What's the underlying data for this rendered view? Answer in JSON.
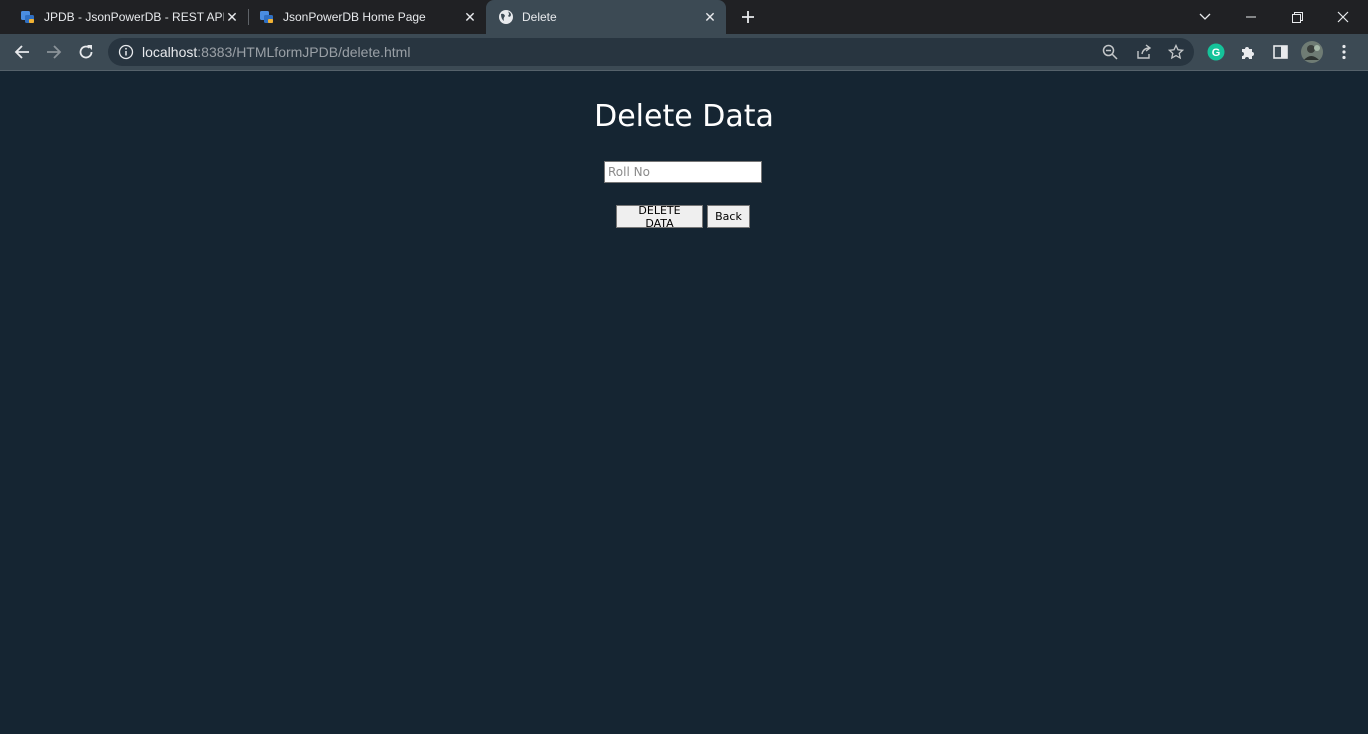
{
  "browser": {
    "tabs": [
      {
        "title": "JPDB - JsonPowerDB - REST API J",
        "active": false,
        "favicon": "jpdb-logo-icon"
      },
      {
        "title": "JsonPowerDB Home Page",
        "active": false,
        "favicon": "jpdb-logo-icon"
      },
      {
        "title": "Delete",
        "active": true,
        "favicon": "globe-icon"
      }
    ],
    "address": {
      "host": "localhost",
      "rest": ":8383/HTMLformJPDB/delete.html"
    },
    "profile_initial": "G"
  },
  "page": {
    "heading": "Delete Data",
    "rollno_placeholder": "Roll No",
    "rollno_value": "",
    "delete_label": "DELETE DATA",
    "back_label": "Back"
  },
  "colors": {
    "page_background": "#152532",
    "tab_active": "#3c4a54",
    "tabstrip": "#202124",
    "grammarly": "#15c39a"
  }
}
